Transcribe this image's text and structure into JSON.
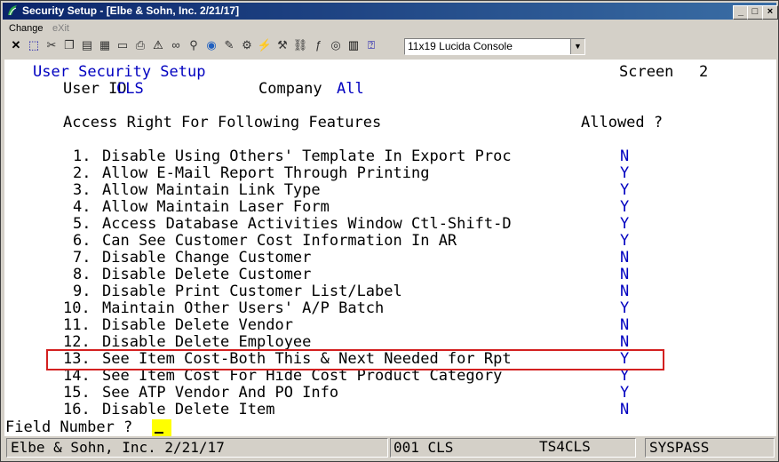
{
  "window": {
    "title": "Security Setup - [Elbe & Sohn, Inc. 2/21/17]",
    "controls": {
      "minimize": "_",
      "restore": "□",
      "close": "×"
    }
  },
  "menu": {
    "items": [
      "Change",
      "eXit"
    ]
  },
  "toolbar": {
    "font_select": "11x19 Lucida Console",
    "icons": [
      "close-icon",
      "select-icon",
      "cut-icon",
      "copy-icon",
      "paste-icon",
      "calculator-icon",
      "page-icon",
      "printer-icon",
      "warning-icon",
      "glasses-icon",
      "search-icon",
      "globe-icon",
      "pen-icon",
      "settings-icon",
      "lightning-icon",
      "tool-icon",
      "link-icon",
      "function-icon",
      "record-icon",
      "notes-icon",
      "help-pointer-icon"
    ]
  },
  "screen": {
    "title": "User Security Setup",
    "screen_label": "Screen",
    "screen_no": "2",
    "user_label": "User ID",
    "user_id": "CLS",
    "company_label": "Company",
    "company": "All",
    "section_header": "Access Right For Following Features",
    "allowed_header": "Allowed ?",
    "features": [
      {
        "num": "1.",
        "label": "Disable Using Others' Template In Export Proc",
        "allowed": "N"
      },
      {
        "num": "2.",
        "label": "Allow E-Mail Report Through Printing",
        "allowed": "Y"
      },
      {
        "num": "3.",
        "label": "Allow Maintain Link Type",
        "allowed": "Y"
      },
      {
        "num": "4.",
        "label": "Allow Maintain Laser Form",
        "allowed": "Y"
      },
      {
        "num": "5.",
        "label": "Access Database Activities Window Ctl-Shift-D",
        "allowed": "Y"
      },
      {
        "num": "6.",
        "label": "Can See Customer Cost Information In AR",
        "allowed": "Y"
      },
      {
        "num": "7.",
        "label": "Disable Change Customer",
        "allowed": "N"
      },
      {
        "num": "8.",
        "label": "Disable Delete Customer",
        "allowed": "N"
      },
      {
        "num": "9.",
        "label": "Disable Print Customer List/Label",
        "allowed": "N"
      },
      {
        "num": "10.",
        "label": "Maintain Other Users' A/P Batch",
        "allowed": "Y"
      },
      {
        "num": "11.",
        "label": "Disable Delete Vendor",
        "allowed": "N"
      },
      {
        "num": "12.",
        "label": "Disable Delete Employee",
        "allowed": "N"
      },
      {
        "num": "13.",
        "label": "See Item Cost-Both This & Next Needed for Rpt",
        "allowed": "Y"
      },
      {
        "num": "14.",
        "label": "See Item Cost For Hide Cost Product Category",
        "allowed": "Y"
      },
      {
        "num": "15.",
        "label": "See ATP Vendor And PO Info",
        "allowed": "Y"
      },
      {
        "num": "16.",
        "label": "Disable Delete Item",
        "allowed": "N"
      }
    ],
    "prompt": "Field Number ?"
  },
  "statusbar": {
    "company": "Elbe & Sohn, Inc. 2/21/17",
    "session": "001 CLS",
    "terminal": "TS4CLS",
    "password": "SYSPASS"
  },
  "colors": {
    "title_bar": "#0a246a",
    "field_value": "#0000c0",
    "highlight_box": "#d32020",
    "cursor": "#ffff00"
  }
}
